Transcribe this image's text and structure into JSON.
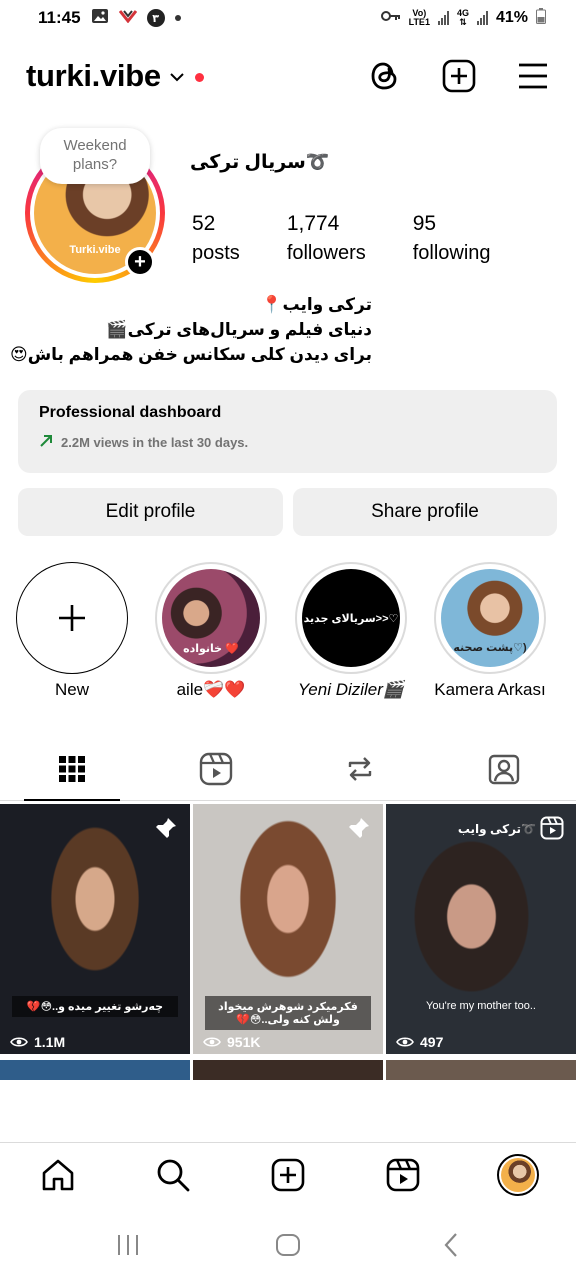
{
  "status_bar": {
    "time": "11:45",
    "notif_badge": "٣",
    "network_label_top": "Vo)",
    "network_label_bottom": "LTE1",
    "network_4g": "4G",
    "battery": "41%"
  },
  "header": {
    "username": "turki.vibe",
    "icons": [
      "threads-icon",
      "create-icon",
      "menu-icon"
    ]
  },
  "profile": {
    "note": "Weekend plans?",
    "avatar_caption": "Turki.vibe",
    "display_name": "سریال ترکی➰",
    "stats": [
      {
        "value": "52",
        "label": "posts"
      },
      {
        "value": "1,774",
        "label": "followers"
      },
      {
        "value": "95",
        "label": "following"
      }
    ],
    "bio": [
      "ترکی وایب📍",
      "دنیای فیلم و سریال‌های ترکی🎬",
      "برای دیدن کلی سکانس خفن همراهم باش😍"
    ]
  },
  "dashboard": {
    "title": "Professional dashboard",
    "subtitle": "2.2M views in the last 30 days."
  },
  "buttons": {
    "edit": "Edit profile",
    "share": "Share profile"
  },
  "highlights": [
    {
      "label": "New"
    },
    {
      "label": "aile❤️‍🩹❤️",
      "thumb_text": "خانواده ❤️"
    },
    {
      "label": "Yeni Diziler🎬",
      "thumb_text": "سریالای جدید>>♡"
    },
    {
      "label": "Kamera Arkası",
      "thumb_text": "پشت صحنه♡)"
    }
  ],
  "tabs": [
    "grid-icon",
    "reels-icon",
    "reposts-icon",
    "tagged-icon"
  ],
  "posts": [
    {
      "caption": "چه‌رشو تغییر میده و..😳💔",
      "views": "1.1M",
      "corner": "pin-icon"
    },
    {
      "caption": "فکرمیکرد شوهرش میخواد ولش کنه ولی..😳💔",
      "views": "951K",
      "corner": "pin-icon"
    },
    {
      "top_caption": "ترکی وایب➰",
      "subtitle": "You're my mother too..",
      "views": "497",
      "corner": "reel-icon"
    }
  ],
  "colors": {
    "accent_red": "#ff3040",
    "secondary_bg": "#efefef",
    "border": "#dbdbdb",
    "muted_text": "#737373"
  }
}
